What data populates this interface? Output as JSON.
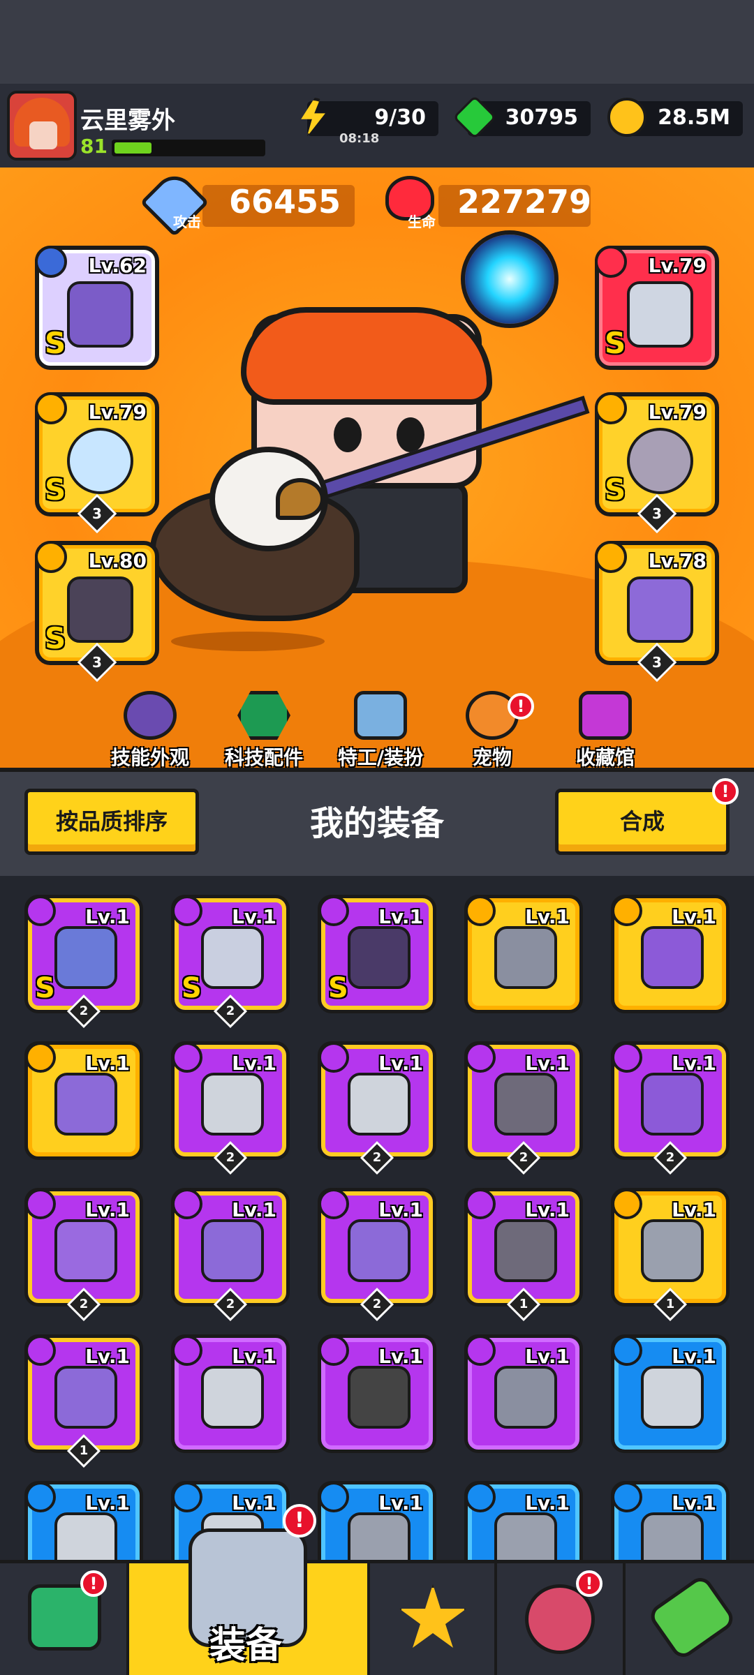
{
  "player": {
    "name": "云里雾外",
    "level": "81",
    "xp_fraction": 0.25
  },
  "resources": {
    "energy": "9/30",
    "energy_timer": "08:18",
    "gems": "30795",
    "gold": "28.5M"
  },
  "stats": {
    "attack_value": "66455",
    "attack_label": "攻击",
    "health_value": "227279",
    "health_label": "生命"
  },
  "equipped": {
    "weapon": {
      "level": "Lv.62",
      "rank": "S"
    },
    "necklace": {
      "level": "Lv.79",
      "rank": "S",
      "count": "3"
    },
    "gloves": {
      "level": "Lv.80",
      "rank": "S",
      "count": "3"
    },
    "armor": {
      "level": "Lv.79",
      "rank": "S"
    },
    "belt": {
      "level": "Lv.79",
      "rank": "S",
      "count": "3"
    },
    "boots": {
      "level": "Lv.78",
      "count": "3"
    }
  },
  "menu": {
    "skill_skin": "技能外观",
    "tech_parts": "科技配件",
    "agent_outfit": "特工/装扮",
    "pets": "宠物",
    "collection": "收藏馆",
    "badge": "!"
  },
  "equipment": {
    "title": "我的装备",
    "sort_button": "按品质排序",
    "merge_button": "合成",
    "items": [
      {
        "lv": "Lv.1",
        "s": "S",
        "cnt": "2"
      },
      {
        "lv": "Lv.1",
        "s": "S",
        "cnt": "2"
      },
      {
        "lv": "Lv.1",
        "s": "S",
        "cnt": ""
      },
      {
        "lv": "Lv.1",
        "s": "",
        "cnt": ""
      },
      {
        "lv": "Lv.1",
        "s": "",
        "cnt": ""
      },
      {
        "lv": "Lv.1",
        "s": "",
        "cnt": ""
      },
      {
        "lv": "Lv.1",
        "s": "",
        "cnt": "2"
      },
      {
        "lv": "Lv.1",
        "s": "",
        "cnt": "2"
      },
      {
        "lv": "Lv.1",
        "s": "",
        "cnt": "2"
      },
      {
        "lv": "Lv.1",
        "s": "",
        "cnt": "2"
      },
      {
        "lv": "Lv.1",
        "s": "",
        "cnt": "2"
      },
      {
        "lv": "Lv.1",
        "s": "",
        "cnt": "2"
      },
      {
        "lv": "Lv.1",
        "s": "",
        "cnt": "2"
      },
      {
        "lv": "Lv.1",
        "s": "",
        "cnt": "1"
      },
      {
        "lv": "Lv.1",
        "s": "",
        "cnt": "1"
      },
      {
        "lv": "Lv.1",
        "s": "",
        "cnt": "1"
      },
      {
        "lv": "Lv.1",
        "s": "",
        "cnt": ""
      },
      {
        "lv": "Lv.1",
        "s": "",
        "cnt": ""
      },
      {
        "lv": "Lv.1",
        "s": "",
        "cnt": ""
      },
      {
        "lv": "Lv.1",
        "s": "",
        "cnt": ""
      },
      {
        "lv": "Lv.1",
        "s": "",
        "cnt": ""
      },
      {
        "lv": "Lv.1",
        "s": "",
        "cnt": ""
      },
      {
        "lv": "Lv.1",
        "s": "",
        "cnt": ""
      },
      {
        "lv": "Lv.1",
        "s": "",
        "cnt": ""
      },
      {
        "lv": "Lv.1",
        "s": "",
        "cnt": ""
      }
    ]
  },
  "nav": {
    "equipment_label": "装备",
    "badge": "!"
  },
  "colors": {
    "orange_bg": "#ff8c10",
    "gold_accent": "#ffd21a",
    "purple_rarity": "#b536ee",
    "blue_rarity": "#168cf2"
  },
  "icons": [
    "lightning-icon",
    "gem-icon",
    "gold-coin-icon",
    "sword-icon",
    "heart-icon",
    "shop-icon",
    "crossed-swords-star-icon",
    "planet-icon",
    "battery-icon"
  ]
}
